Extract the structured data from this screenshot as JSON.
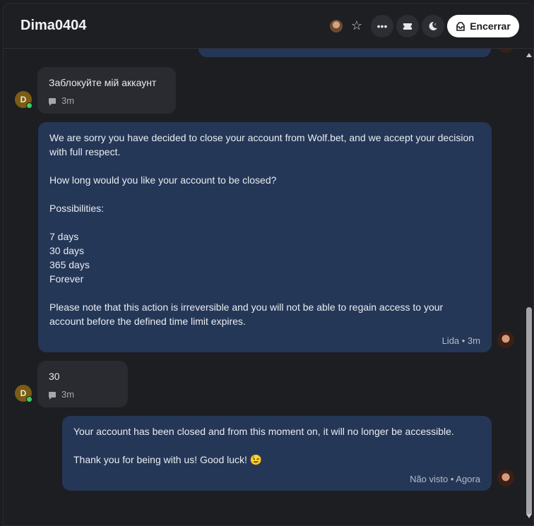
{
  "header": {
    "title": "Dima0404",
    "end_label": "Encerrar",
    "icons": [
      "avatar",
      "star-icon",
      "more-icon",
      "ticket-icon",
      "snooze-icon",
      "close-conversation-icon"
    ]
  },
  "messages": [
    {
      "from": "user",
      "avatar_letter": "D",
      "text": "Заблокуйте мій аккаунт",
      "time": "3m"
    },
    {
      "from": "agent",
      "paragraphs": [
        "We are sorry you have decided to close your account from Wolf.bet, and we accept your decision with full respect.",
        "How long would you like your account to be closed?",
        "Possibilities:",
        "7 days\n30 days\n365 days\nForever",
        "Please note that this action is irreversible and you will not be able to regain access to your account before the defined time limit expires."
      ],
      "meta": "Lida • 3m"
    },
    {
      "from": "user",
      "avatar_letter": "D",
      "text": "30",
      "time": "3m"
    },
    {
      "from": "agent",
      "paragraphs": [
        "Your account has been closed and from this moment on, it will no longer be accessible.",
        "Thank you for being with us! Good luck! 😉"
      ],
      "meta": "Não visto • Agora"
    }
  ],
  "colors": {
    "background": "#1d1e22",
    "agent_bubble": "#253757",
    "user_bubble": "#2a2b30",
    "online": "#3ccf63",
    "end_button": "#ffffff"
  }
}
